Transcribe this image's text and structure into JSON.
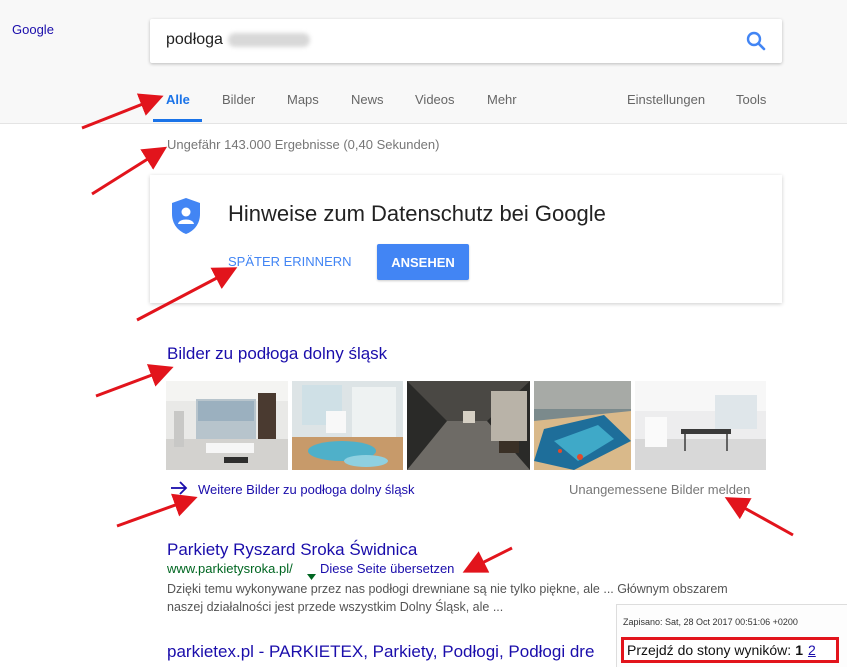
{
  "header": {
    "logo": "Google",
    "search_query": "podłoga",
    "tabs": [
      {
        "label": "Alle",
        "active": true
      },
      {
        "label": "Bilder"
      },
      {
        "label": "Maps"
      },
      {
        "label": "News"
      },
      {
        "label": "Videos"
      },
      {
        "label": "Mehr"
      },
      {
        "label": "Einstellungen"
      },
      {
        "label": "Tools"
      }
    ]
  },
  "result_stats": "Ungefähr 143.000 Ergebnisse (0,40 Sekunden)",
  "privacy": {
    "title": "Hinweise zum Datenschutz bei Google",
    "remind_later": "SPÄTER ERINNERN",
    "view": "ANSEHEN"
  },
  "images": {
    "heading": "Bilder zu podłoga dolny śląsk",
    "more_link": "Weitere Bilder zu podłoga dolny śląsk",
    "report_link": "Unangemessene Bilder melden"
  },
  "results": [
    {
      "title": "Parkiety Ryszard Sroka Świdnica",
      "url": "www.parkietysroka.pl/",
      "translate": "Diese Seite übersetzen",
      "snippet_line1": "Dzięki temu wykonywane przez nas podłogi drewniane są nie tylko piękne, ale ... Głównym obszarem",
      "snippet_line2": "naszej działalności jest przede wszystkim Dolny Śląsk, ale ..."
    },
    {
      "title": "parkietex.pl - PARKIETEX, Parkiety, Podłogi, Podłogi dre"
    }
  ],
  "overlay": {
    "saved": "Zapisano: Sat, 28 Oct 2017 00:51:06 +0200",
    "goto_label": "Przejdź do stony wyników:",
    "page_current": "1",
    "page_next": "2"
  },
  "colors": {
    "accent": "#1a73e8",
    "link": "#1a0dab",
    "url_green": "#006621",
    "annotation_red": "#e2141c"
  }
}
